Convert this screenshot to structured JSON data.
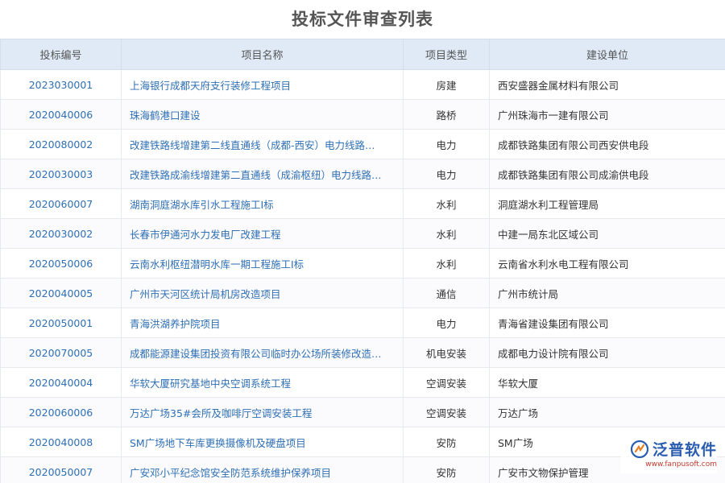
{
  "title": "投标文件审查列表",
  "columns": [
    "投标编号",
    "项目名称",
    "项目类型",
    "建设单位"
  ],
  "rows": [
    {
      "code": "2023030001",
      "name": "上海银行成都天府支行装修工程项目",
      "type": "房建",
      "unit": "西安盛器金属材料有限公司"
    },
    {
      "code": "2020040006",
      "name": "珠海鹤港口建设",
      "type": "路桥",
      "unit": "广州珠海市一建有限公司"
    },
    {
      "code": "2020080002",
      "name": "改建铁路线增建第二线直通线（成都-西安）电力线路…",
      "type": "电力",
      "unit": "成都铁路集团有限公司西安供电段"
    },
    {
      "code": "2020030003",
      "name": "改建铁路成渝线增建第二直通线（成渝枢纽）电力线路…",
      "type": "电力",
      "unit": "成都铁路集团有限公司成渝供电段"
    },
    {
      "code": "2020060007",
      "name": "湖南洞庭湖水库引水工程施工Ⅰ标",
      "type": "水利",
      "unit": "洞庭湖水利工程管理局"
    },
    {
      "code": "2020030002",
      "name": "长春市伊通河水力发电厂改建工程",
      "type": "水利",
      "unit": "中建一局东北区域公司"
    },
    {
      "code": "2020050006",
      "name": "云南水利枢纽潜明水库一期工程施工Ⅰ标",
      "type": "水利",
      "unit": "云南省水利水电工程有限公司"
    },
    {
      "code": "2020040005",
      "name": "广州市天河区统计局机房改造项目",
      "type": "通信",
      "unit": "广州市统计局"
    },
    {
      "code": "2020050001",
      "name": "青海洪湖养护院项目",
      "type": "电力",
      "unit": "青海省建设集团有限公司"
    },
    {
      "code": "2020070005",
      "name": "成都能源建设集团投资有限公司临时办公场所装修改造…",
      "type": "机电安装",
      "unit": "成都电力设计院有限公司"
    },
    {
      "code": "2020040004",
      "name": "华软大厦研究基地中央空调系统工程",
      "type": "空调安装",
      "unit": "华软大厦"
    },
    {
      "code": "2020060006",
      "name": "万达广场35#会所及咖啡厅空调安装工程",
      "type": "空调安装",
      "unit": "万达广场"
    },
    {
      "code": "2020040008",
      "name": "SM广场地下车库更换摄像机及硬盘项目",
      "type": "安防",
      "unit": "SM广场"
    },
    {
      "code": "2020050007",
      "name": "广安邓小平纪念馆安全防范系统维护保养项目",
      "type": "安防",
      "unit": "广安市文物保护管理"
    }
  ],
  "logo": {
    "text": "泛普软件",
    "url": "www.fanpusoft.com",
    "icon": "fanpu-logo-icon"
  },
  "colors": {
    "header_bg": "#dfeaf6",
    "link": "#2f6fb4",
    "logo": "#2a5db0"
  }
}
